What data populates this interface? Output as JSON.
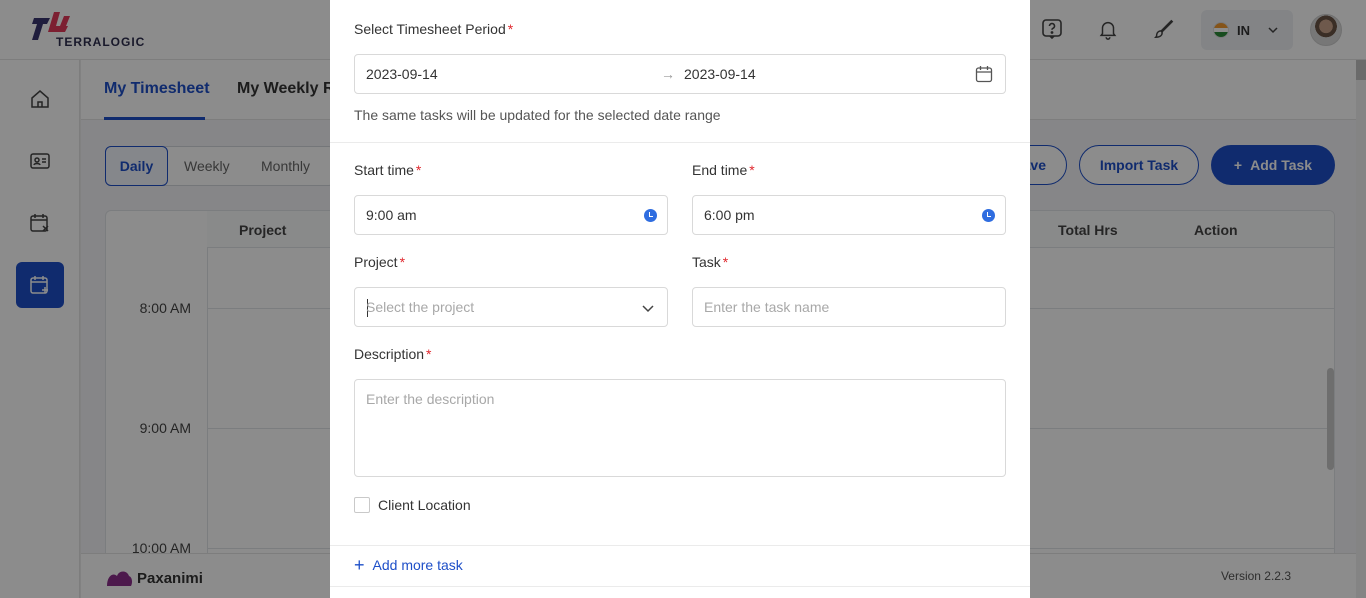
{
  "header": {
    "logo_text": "TERRALOGIC",
    "language_code": "IN",
    "icons": [
      "help-icon",
      "bell-icon",
      "brush-icon"
    ]
  },
  "sidebar": {
    "items": [
      {
        "icon": "home-icon",
        "active": false
      },
      {
        "icon": "id-card-icon",
        "active": false
      },
      {
        "icon": "calendar-x-icon",
        "active": false
      },
      {
        "icon": "calendar-plus-icon",
        "active": true
      }
    ]
  },
  "page": {
    "tabs": [
      "My Timesheet",
      "My Weekly Re"
    ],
    "views": {
      "daily": "Daily",
      "weekly": "Weekly",
      "monthly": "Monthly"
    },
    "save_partial": "ave",
    "import_task": "Import Task",
    "add_task": "Add Task",
    "grid_headers": {
      "project": "Project",
      "total_hrs": "Total Hrs",
      "action": "Action"
    },
    "times": [
      "8:00 AM",
      "9:00 AM",
      "10:00 AM"
    ]
  },
  "footer": {
    "brand": "Paxanimi",
    "version": "Version 2.2.3"
  },
  "modal": {
    "period_label": "Select Timesheet Period",
    "start_date": "2023-09-14",
    "end_date": "2023-09-14",
    "arrow": "→",
    "hint": "The same tasks will be updated for the selected date range",
    "start_time_label": "Start time",
    "start_time_value": "9:00 am",
    "end_time_label": "End time",
    "end_time_value": "6:00 pm",
    "project_label": "Project",
    "project_placeholder": "Select the project",
    "task_label": "Task",
    "task_placeholder": "Enter the task name",
    "description_label": "Description",
    "description_placeholder": "Enter the description",
    "client_location_label": "Client Location",
    "client_location_checked": false,
    "add_more_label": "Add more task",
    "required_mark": "*"
  },
  "colors": {
    "accent": "#1e4fc8",
    "required": "#e0282e"
  }
}
